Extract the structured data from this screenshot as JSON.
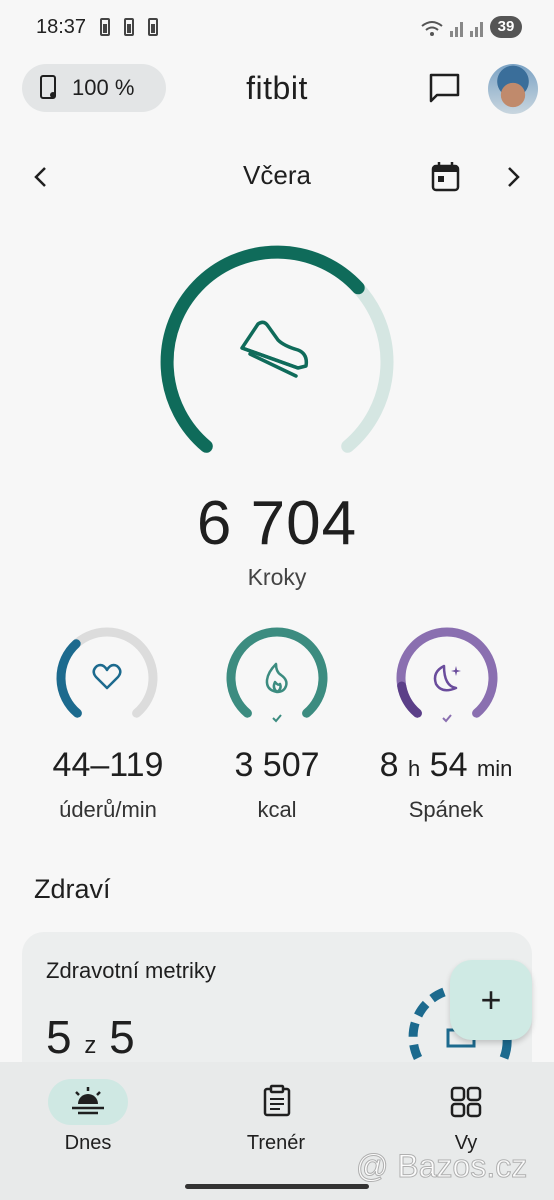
{
  "status_bar": {
    "time": "18:37",
    "battery_level": "39"
  },
  "header": {
    "device_battery": "100 %",
    "app_title": "fitbit",
    "icons": [
      "device-icon",
      "chat-icon",
      "avatar"
    ]
  },
  "date_nav": {
    "label": "Včera",
    "prev_icon": "chevron-left-icon",
    "next_icon": "chevron-right-icon",
    "calendar_icon": "calendar-icon"
  },
  "steps": {
    "value": "6 704",
    "label": "Kroky",
    "icon": "shoe-icon",
    "progress": 0.67
  },
  "metrics": [
    {
      "value": "44–119",
      "label": "úderů/min",
      "icon": "heart-icon",
      "progress": 0.35
    },
    {
      "value": "3 507",
      "label": "kcal",
      "icon": "flame-icon",
      "progress": 1.0
    },
    {
      "value_h": "8",
      "unit_h": "h",
      "value_m": "54",
      "unit_m": "min",
      "label": "Spánek",
      "icon": "moon-icon",
      "progress": 1.0
    }
  ],
  "health": {
    "section_title": "Zdraví",
    "card_title": "Zdravotní metriky",
    "score_value": "5",
    "score_mid": "z",
    "score_total": "5"
  },
  "fab": {
    "label": "+"
  },
  "bottom_nav": [
    {
      "label": "Dnes",
      "icon": "sunrise-icon",
      "active": true
    },
    {
      "label": "Trenér",
      "icon": "clipboard-icon",
      "active": false
    },
    {
      "label": "Vy",
      "icon": "grid-icon",
      "active": false
    }
  ],
  "colors": {
    "steps_ring": "#0f6b5a",
    "steps_track": "#d5e6e2",
    "heart_ring": "#1c6a8e",
    "kcal_ring": "#3c8c80",
    "sleep_ring": "#8a6fb0",
    "sleep_dark": "#5b3f88"
  },
  "watermark": "@ Bazos.cz"
}
